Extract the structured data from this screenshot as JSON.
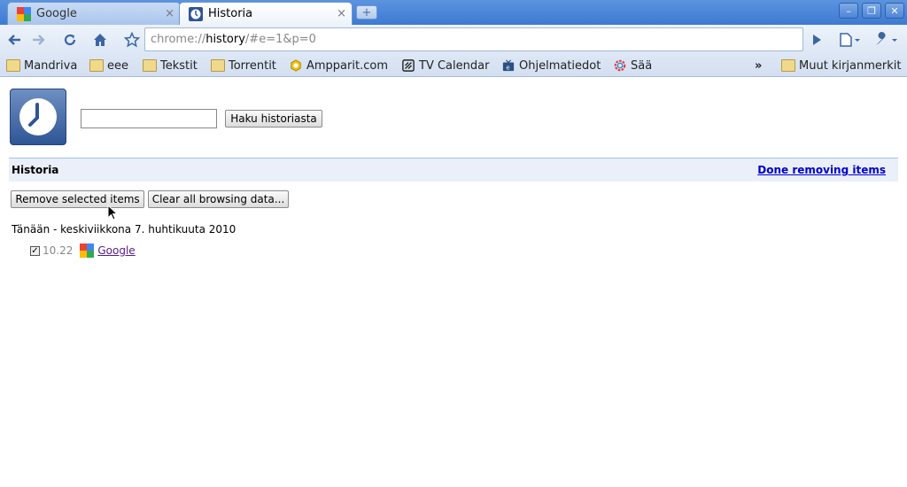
{
  "tabs": [
    {
      "title": "Google",
      "close": "×"
    },
    {
      "title": "Historia",
      "close": "×"
    }
  ],
  "window_controls": {
    "minimize": "–",
    "maximize": "❐",
    "close": "✕"
  },
  "toolbar": {
    "url_prefix": "chrome://",
    "url_host": "history",
    "url_suffix": "/#e=1&p=0"
  },
  "bookmarks": [
    {
      "label": "Mandriva",
      "icon": "folder-icon"
    },
    {
      "label": "eee",
      "icon": "folder-icon"
    },
    {
      "label": "Tekstit",
      "icon": "folder-icon"
    },
    {
      "label": "Torrentit",
      "icon": "folder-icon"
    },
    {
      "label": "Ampparit.com",
      "icon": "ampparit-icon"
    },
    {
      "label": "TV Calendar",
      "icon": "tvcalendar-icon"
    },
    {
      "label": "Ohjelmatiedot",
      "icon": "tv-icon"
    },
    {
      "label": "Sää",
      "icon": "weather-icon"
    },
    {
      "label": "Muut kirjanmerkit",
      "icon": "folder-icon"
    }
  ],
  "bookmarks_overflow": "»",
  "search": {
    "button_label": "Haku historiasta",
    "value": ""
  },
  "section": {
    "title": "Historia",
    "done_link": "Done removing items"
  },
  "actions": {
    "remove_selected": "Remove selected items",
    "clear_all": "Clear all browsing data..."
  },
  "day_label": "Tänään - keskiviikkona 7. huhtikuuta 2010",
  "entries": [
    {
      "checked": true,
      "time": "10.22",
      "title": "Google"
    }
  ],
  "colors": {
    "tabstrip": "#3f7ad3",
    "link_visited": "#551a8b",
    "link": "#0000cc",
    "section_bg": "#ebeff9"
  }
}
